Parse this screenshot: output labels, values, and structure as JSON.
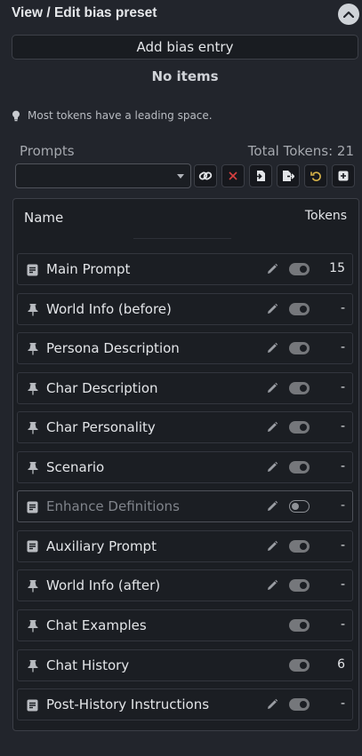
{
  "header": {
    "title": "View / Edit bias preset"
  },
  "bias": {
    "add_label": "Add bias entry",
    "empty_text": "No items"
  },
  "hint": {
    "text": "Most tokens have a leading space."
  },
  "prompts": {
    "label": "Prompts",
    "total_tokens": "Total Tokens: 21",
    "selected": ""
  },
  "table": {
    "col_name": "Name",
    "col_tokens": "Tokens"
  },
  "colors": {
    "background": "#22252c",
    "panel": "#1b1e23",
    "delete_icon": "#d94040",
    "reset_icon": "#d8b44a",
    "toggle_on": "#75777b"
  },
  "items": [
    {
      "label": "Main Prompt",
      "icon": "document-icon",
      "tokens": "15",
      "editable": true,
      "enabled": true
    },
    {
      "label": "World Info (before)",
      "icon": "pin-icon",
      "tokens": "-",
      "editable": true,
      "enabled": true
    },
    {
      "label": "Persona Description",
      "icon": "pin-icon",
      "tokens": "-",
      "editable": true,
      "enabled": true
    },
    {
      "label": "Char Description",
      "icon": "pin-icon",
      "tokens": "-",
      "editable": true,
      "enabled": true
    },
    {
      "label": "Char Personality",
      "icon": "pin-icon",
      "tokens": "-",
      "editable": true,
      "enabled": true
    },
    {
      "label": "Scenario",
      "icon": "pin-icon",
      "tokens": "-",
      "editable": true,
      "enabled": true
    },
    {
      "label": "Enhance Definitions",
      "icon": "document-icon",
      "tokens": "-",
      "editable": true,
      "enabled": false
    },
    {
      "label": "Auxiliary Prompt",
      "icon": "document-icon",
      "tokens": "-",
      "editable": true,
      "enabled": true
    },
    {
      "label": "World Info (after)",
      "icon": "pin-icon",
      "tokens": "-",
      "editable": true,
      "enabled": true
    },
    {
      "label": "Chat Examples",
      "icon": "pin-icon",
      "tokens": "-",
      "editable": false,
      "enabled": true
    },
    {
      "label": "Chat History",
      "icon": "pin-icon",
      "tokens": "6",
      "editable": false,
      "enabled": true
    },
    {
      "label": "Post-History Instructions",
      "icon": "document-icon",
      "tokens": "-",
      "editable": true,
      "enabled": true
    }
  ]
}
